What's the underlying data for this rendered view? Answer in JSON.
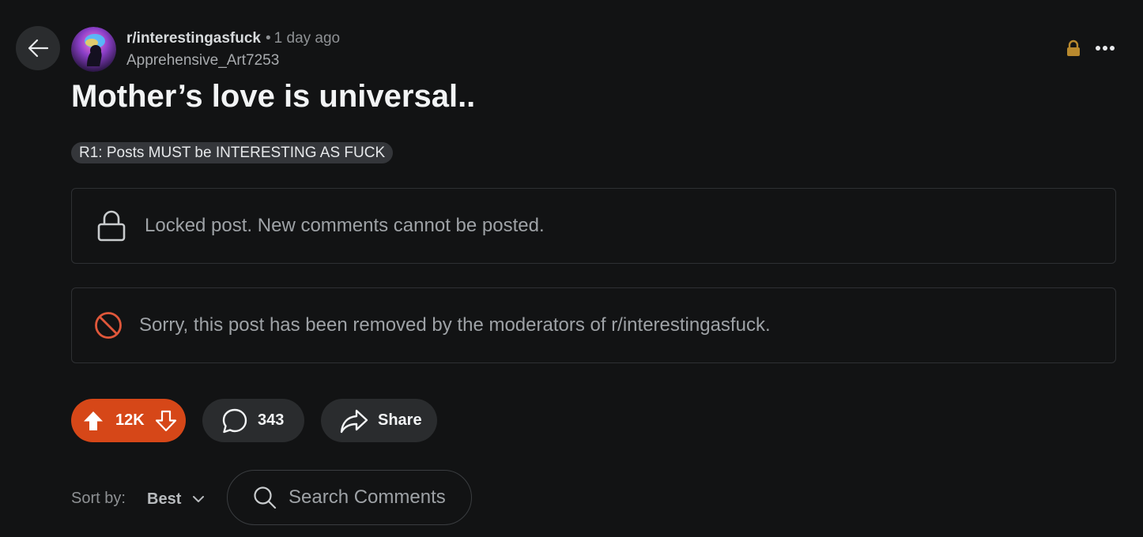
{
  "post": {
    "subreddit": "r/interestingasfuck",
    "separator": "•",
    "time_ago": "1 day ago",
    "author": "Apprehensive_Art7253",
    "title": "Mother’s love is universal..",
    "flair": "R1: Posts MUST be INTERESTING AS FUCK"
  },
  "notices": {
    "locked": "Locked post. New comments cannot be posted.",
    "removed": "Sorry, this post has been removed by the moderators of r/interestingasfuck."
  },
  "actions": {
    "votes": "12K",
    "comments": "343",
    "share": "Share"
  },
  "comments_bar": {
    "sort_label": "Sort by:",
    "sort_value": "Best",
    "search_placeholder": "Search Comments"
  },
  "colors": {
    "background": "#121314",
    "vote_active": "#d64718",
    "lock_icon": "#b8892e",
    "removed_icon": "#e0573a"
  },
  "icons": {
    "back": "arrow-left-icon",
    "lock": "lock-icon",
    "more": "more-horizontal-icon",
    "removed": "prohibited-icon",
    "upvote": "upvote-filled-icon",
    "downvote": "downvote-outline-icon",
    "comment": "comment-bubble-icon",
    "share": "share-arrow-icon",
    "chevron": "chevron-down-icon",
    "search": "search-icon"
  }
}
